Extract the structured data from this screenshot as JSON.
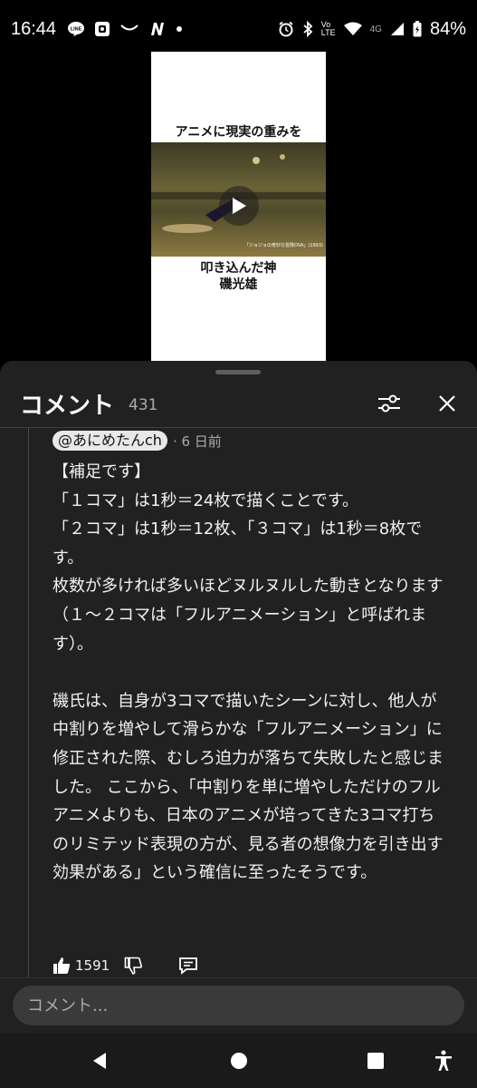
{
  "status_bar": {
    "time": "16:44",
    "left_icons": [
      "line-icon",
      "camera-icon",
      "mail-icon",
      "n-app-icon",
      "dot-icon"
    ],
    "volte": "Vo\nLTE",
    "network": "4G",
    "battery": "84%"
  },
  "video": {
    "caption_top": "アニメに現実の重みを",
    "caption_bottom_1": "叩き込んだ神",
    "caption_bottom_2": "磯光雄",
    "credit": "「ジョジョの奇妙な冒険OVA」(1993)"
  },
  "comments_sheet": {
    "title": "コメント",
    "count": "431",
    "comment": {
      "author": "@あにめたんch",
      "time": "· 6 日前",
      "body": "【補足です】\n「１コマ」は1秒＝24枚で描くことです。\n「２コマ」は1秒＝12枚、「３コマ」は1秒＝8枚です。\n枚数が多ければ多いほどヌルヌルした動きとなります（１～２コマは「フルアニメーション」と呼ばれます）。\n\n磯氏は、自身が3コマで描いたシーンに対し、他人が中割りを増やして滑らかな「フルアニメーション」に修正された際、むしろ迫力が落ちて失敗したと感じました。 ここから、「中割りを単に増やしただけのフルアニメよりも、日本のアニメが培ってきた3コマ打ちのリミテッド表現の方が、見る者の想像力を引き出す効果がある」という確信に至ったそうです。",
      "likes": "1591"
    },
    "input_placeholder": "コメント..."
  }
}
